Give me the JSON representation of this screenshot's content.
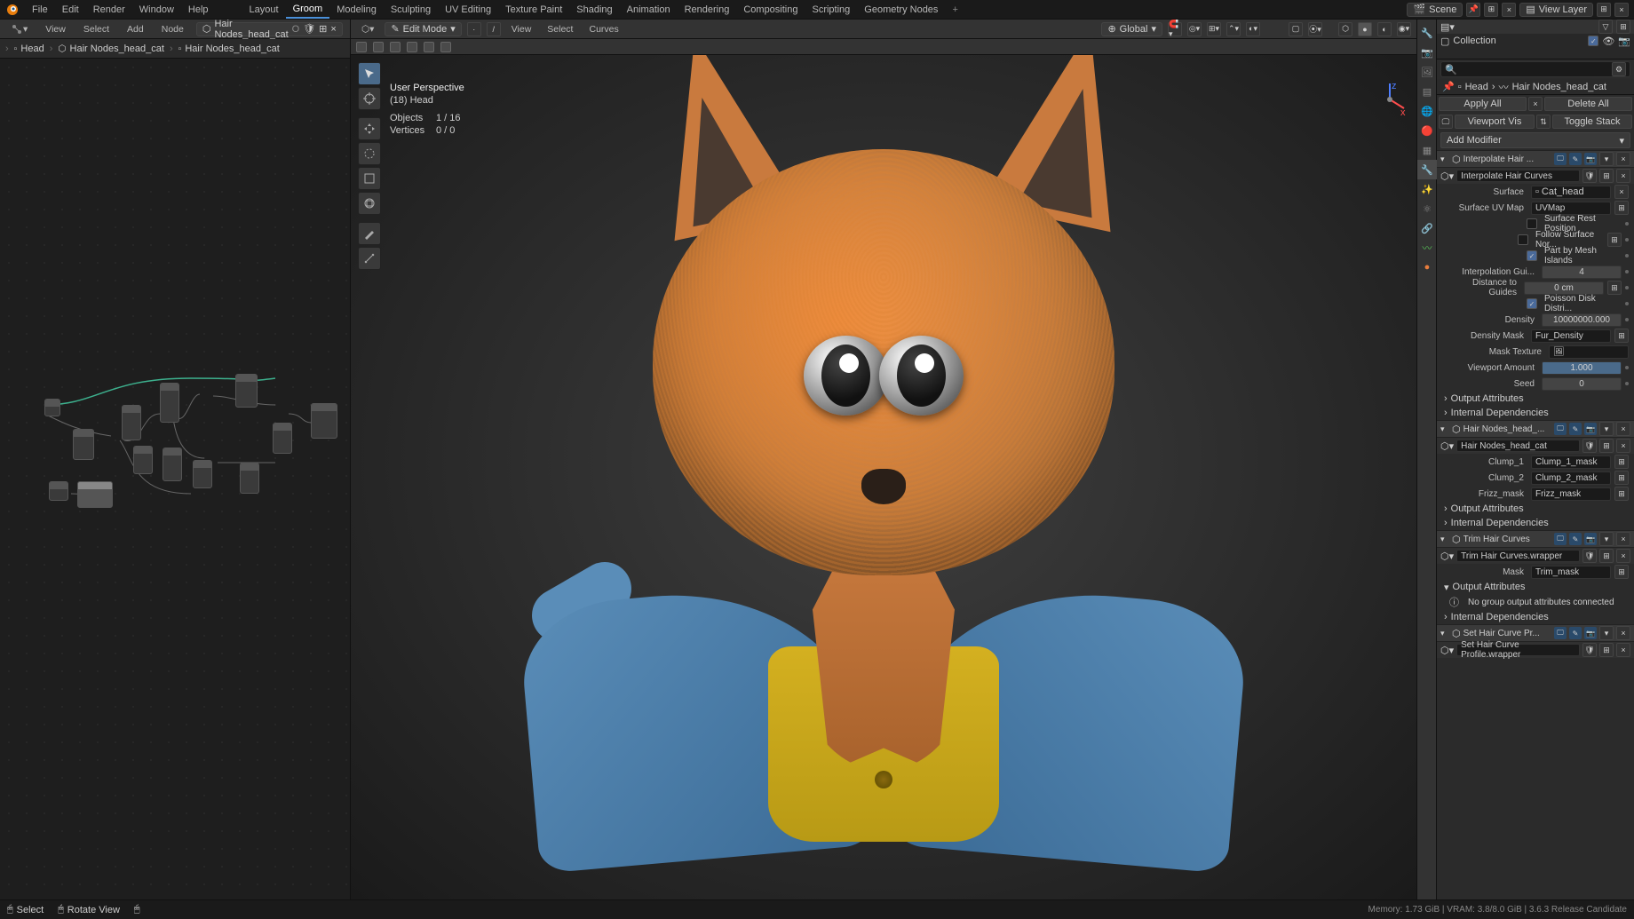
{
  "topbar": {
    "menus": [
      "File",
      "Edit",
      "Render",
      "Window",
      "Help"
    ],
    "tabs": [
      "Layout",
      "Groom",
      "Modeling",
      "Sculpting",
      "UV Editing",
      "Texture Paint",
      "Shading",
      "Animation",
      "Rendering",
      "Compositing",
      "Scripting",
      "Geometry Nodes"
    ],
    "active_tab": "Groom",
    "scene_label": "Scene",
    "view_layer_label": "View Layer"
  },
  "node_panel": {
    "menus": [
      "View",
      "Select",
      "Add",
      "Node"
    ],
    "linked_datablock": "Hair Nodes_head_cat",
    "breadcrumb": [
      "Head",
      "Hair Nodes_head_cat",
      "Hair Nodes_head_cat"
    ]
  },
  "viewport": {
    "mode": "Edit Mode",
    "menus": [
      "View",
      "Select",
      "Curves"
    ],
    "orientation": "Global",
    "overlay_title": "User Perspective",
    "overlay_sub": "(18) Head",
    "stats": {
      "objects": "1 / 16",
      "vertices": "0 / 0"
    },
    "stat_labels": {
      "objects": "Objects",
      "vertices": "Vertices"
    }
  },
  "outliner": {
    "header_label": "Collection",
    "search_placeholder": "",
    "breadcrumb": [
      "Head",
      "Hair Nodes_head_cat"
    ]
  },
  "properties": {
    "btn_apply_all": "Apply All",
    "btn_delete_all": "Delete All",
    "btn_viewport_vis": "Viewport Vis",
    "btn_toggle_stack": "Toggle Stack",
    "add_modifier": "Add Modifier",
    "modifiers": [
      {
        "title": "Interpolate Hair ...",
        "node_group": "Interpolate Hair Curves",
        "fields": {
          "surface_label": "Surface",
          "surface_value": "Cat_head",
          "uv_label": "Surface UV Map",
          "uv_value": "UVMap",
          "rest_pos": "Surface Rest Position",
          "follow_normal": "Follow Surface Nor...",
          "part_islands": "Part by Mesh Islands",
          "interp_gui": "Interpolation Gui...",
          "interp_gui_val": "4",
          "dist_guides": "Distance to Guides",
          "dist_guides_val": "0 cm",
          "poisson": "Poisson Disk Distri...",
          "density_label": "Density",
          "density_val": "10000000.000",
          "density_mask_label": "Density Mask",
          "density_mask_val": "Fur_Density",
          "mask_tex": "Mask Texture",
          "vp_amount": "Viewport Amount",
          "vp_amount_val": "1.000",
          "seed": "Seed",
          "seed_val": "0"
        },
        "out_attrs": "Output Attributes",
        "int_deps": "Internal Dependencies"
      },
      {
        "title": "Hair Nodes_head_...",
        "node_group": "Hair Nodes_head_cat",
        "fields": {
          "clump1_label": "Clump_1",
          "clump1_val": "Clump_1_mask",
          "clump2_label": "Clump_2",
          "clump2_val": "Clump_2_mask",
          "frizz_label": "Frizz_mask",
          "frizz_val": "Frizz_mask"
        },
        "out_attrs": "Output Attributes",
        "int_deps": "Internal Dependencies"
      },
      {
        "title": "Trim Hair Curves",
        "node_group": "Trim Hair Curves.wrapper",
        "fields": {
          "mask_label": "Mask",
          "mask_val": "Trim_mask"
        },
        "out_attrs": "Output Attributes",
        "out_msg": "No group output attributes connected",
        "int_deps": "Internal Dependencies"
      },
      {
        "title": "Set Hair Curve Pr...",
        "node_group": "Set Hair Curve Profile.wrapper"
      }
    ]
  },
  "status_bar": {
    "left": [
      "Select",
      "Rotate View",
      ""
    ],
    "right": "Memory: 1.73 GiB | VRAM: 3.8/8.0 GiB | 3.6.3 Release Candidate"
  }
}
